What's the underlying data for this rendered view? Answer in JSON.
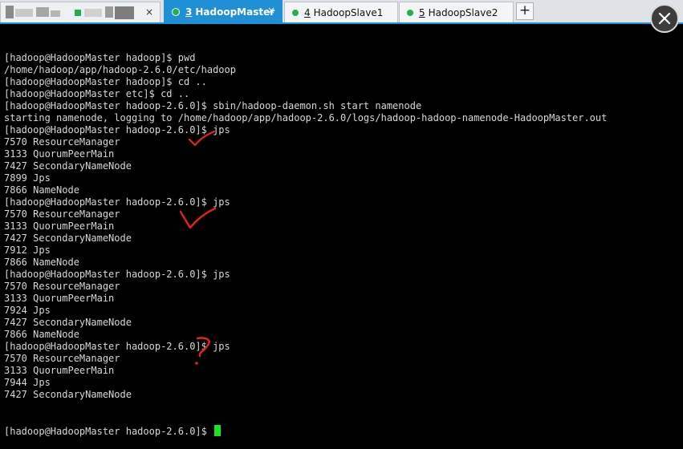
{
  "tabs": [
    {
      "label": "",
      "pixelated": true
    },
    {
      "number": "3",
      "name": "HadoopMaster",
      "active": true,
      "close": "×"
    },
    {
      "number": "4",
      "name": "HadoopSlave1",
      "active": false
    },
    {
      "number": "5",
      "name": "HadoopSlave2",
      "active": false
    }
  ],
  "new_tab_label": "+",
  "colors": {
    "accent": "#1f8fd6",
    "status_dot": "#22b14c",
    "cursor": "#19e619",
    "annotation": "#e8231d"
  },
  "terminal": {
    "lines": [
      "[hadoop@HadoopMaster hadoop]$ pwd",
      "/home/hadoop/app/hadoop-2.6.0/etc/hadoop",
      "[hadoop@HadoopMaster hadoop]$ cd ..",
      "[hadoop@HadoopMaster etc]$ cd ..",
      "[hadoop@HadoopMaster hadoop-2.6.0]$ sbin/hadoop-daemon.sh start namenode",
      "starting namenode, logging to /home/hadoop/app/hadoop-2.6.0/logs/hadoop-hadoop-namenode-HadoopMaster.out",
      "[hadoop@HadoopMaster hadoop-2.6.0]$ jps",
      "7570 ResourceManager",
      "3133 QuorumPeerMain",
      "7427 SecondaryNameNode",
      "7899 Jps",
      "7866 NameNode",
      "[hadoop@HadoopMaster hadoop-2.6.0]$ jps",
      "7570 ResourceManager",
      "3133 QuorumPeerMain",
      "7427 SecondaryNameNode",
      "7912 Jps",
      "7866 NameNode",
      "[hadoop@HadoopMaster hadoop-2.6.0]$ jps",
      "7570 ResourceManager",
      "3133 QuorumPeerMain",
      "7924 Jps",
      "7427 SecondaryNameNode",
      "7866 NameNode",
      "[hadoop@HadoopMaster hadoop-2.6.0]$ jps",
      "7570 ResourceManager",
      "3133 QuorumPeerMain",
      "7944 Jps",
      "7427 SecondaryNameNode"
    ],
    "prompt": "[hadoop@HadoopMaster hadoop-2.6.0]$ "
  },
  "icons": {
    "close": "close-icon",
    "annotations": [
      "checkmark-annotation",
      "checkmark-annotation",
      "question-mark-annotation"
    ]
  }
}
